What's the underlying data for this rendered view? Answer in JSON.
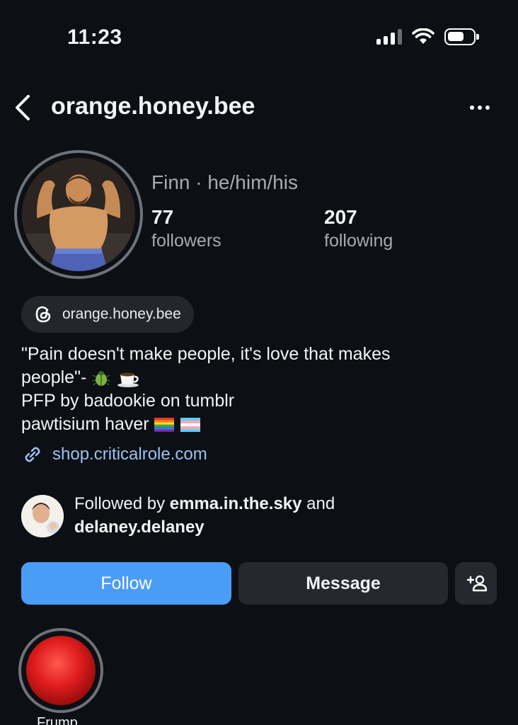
{
  "status_bar": {
    "time": "11:23",
    "signal_bars_filled": 3,
    "signal_bars_total": 4,
    "battery_fraction": 0.6
  },
  "header": {
    "username": "orange.honey.bee",
    "back_icon": "chevron-left-icon",
    "more_icon": "ellipsis-icon"
  },
  "profile": {
    "name_line": "Finn · he/him/his",
    "followers": {
      "count": "77",
      "label": "followers"
    },
    "following": {
      "count": "207",
      "label": "following"
    },
    "threads_handle": "orange.honey.bee",
    "bio": {
      "line1": "\"Pain doesn't make people, it's love that makes",
      "line2": "people\"-",
      "line3": "PFP by badookie on tumblr",
      "line4": "pawtisium haver"
    },
    "link": "shop.criticalrole.com"
  },
  "followed_by": {
    "prefix": "Followed by ",
    "user1": "emma.in.the.sky",
    "middle": " and",
    "user2": "delaney.delaney"
  },
  "actions": {
    "follow": "Follow",
    "message": "Message"
  },
  "highlights": [
    {
      "label": "Frump"
    }
  ],
  "colors": {
    "background": "#0c0f14",
    "accent_blue": "#4a9df7",
    "link": "#9bc2ef",
    "secondary_text": "#a8acb2"
  }
}
